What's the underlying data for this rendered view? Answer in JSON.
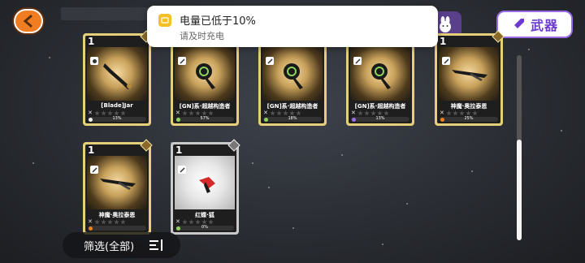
{
  "notification": {
    "title": "电量已低于10%",
    "body": "请及时充电",
    "icon": "battery-icon"
  },
  "tabs": {
    "weapon_label": "武器"
  },
  "filter": {
    "label": "筛选(全部)"
  },
  "colors": {
    "gold_frame": "#e6cf7a",
    "silver_frame": "#c9c9c9",
    "accent_purple": "#6b3bd1",
    "back_orange": "#f07d22"
  },
  "cards": [
    {
      "name": "[Blade]Jar",
      "grade": "1",
      "pct": "13%",
      "progress": 0.13,
      "frame": "gold",
      "dot_color": "#f2f2f2"
    },
    {
      "name": "[GN]系·超越构造者",
      "grade": "1",
      "pct": "57%",
      "progress": 0.57,
      "frame": "gold",
      "dot_color": "#8ed35c"
    },
    {
      "name": "[GN]系·超越构造者",
      "grade": "1",
      "pct": "18%",
      "progress": 0.18,
      "frame": "gold",
      "dot_color": "#8ed35c"
    },
    {
      "name": "[GN]系·超越构造者",
      "grade": "1",
      "pct": "13%",
      "progress": 0.13,
      "frame": "gold",
      "dot_color": "#9b6cf0"
    },
    {
      "name": "神魔·奥拉泰恩",
      "grade": "1",
      "pct": "25%",
      "progress": 0.25,
      "frame": "gold",
      "dot_color": "#f07d22"
    },
    {
      "name": "神魔·奥拉泰恩",
      "grade": "1",
      "pct": "",
      "progress": 0.15,
      "frame": "gold",
      "dot_color": "#f07d22"
    },
    {
      "name": "红蝶·狐",
      "grade": "1",
      "pct": "0%",
      "progress": 0.0,
      "frame": "silver",
      "dot_color": "#8ed35c"
    }
  ]
}
